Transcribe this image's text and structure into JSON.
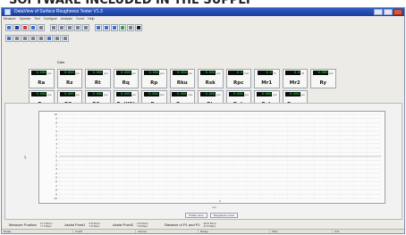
{
  "heading": "SOFTWARE INCLUDED IN THE SUPPLY",
  "window": {
    "title": "DataView of Surface Roughness Tester  V1.3",
    "menu": [
      "Measure",
      "Operate",
      "Tool",
      "Configure",
      "Analysis",
      "Curve",
      "Help"
    ]
  },
  "toolbar": {
    "row1": [
      "open-icon",
      "save-icon",
      "stop-icon",
      "chart-icon",
      "print-icon",
      "zoom-icon",
      "pen-icon",
      "level-icon",
      "scale-icon",
      "ruler-icon",
      "add-icon",
      "star-icon",
      "magnify-icon",
      "table-icon",
      "list-icon",
      "black-square-icon"
    ],
    "row2": [
      "home-icon",
      "play-icon",
      "grid-icon",
      "page-icon",
      "link-icon",
      "export-icon",
      "settings-icon",
      "undo-icon"
    ]
  },
  "params": {
    "date_label": "Date",
    "row1": [
      {
        "value": "0.000",
        "unit": "μm",
        "name": "Ra"
      },
      {
        "value": "0.000",
        "unit": "μm",
        "name": "Rz"
      },
      {
        "value": "0.000",
        "unit": "μm",
        "name": "Rt"
      },
      {
        "value": "0.000",
        "unit": "μm",
        "name": "Rq"
      },
      {
        "value": "0.000",
        "unit": "μm",
        "name": "Rp"
      },
      {
        "value": "0.000",
        "unit": "μm",
        "name": "Rku"
      },
      {
        "value": "0.000",
        "unit": "μm",
        "name": "Rsk"
      },
      {
        "value": "0.0",
        "unit": "mm",
        "name": "Rpc"
      },
      {
        "value": "0.0",
        "unit": "%",
        "name": "Mr1"
      },
      {
        "value": "0.0",
        "unit": "%",
        "name": "Mr2"
      },
      {
        "value": "0.000",
        "unit": "μm",
        "name": "Ry"
      }
    ],
    "row2": [
      {
        "value": "0.000",
        "unit": "μm",
        "name": "Rv"
      },
      {
        "value": "0.000",
        "unit": "μm",
        "name": "R3z"
      },
      {
        "value": "0.000",
        "unit": "μm",
        "name": "R3y"
      },
      {
        "value": "0.000",
        "unit": "μm",
        "name": "Rz(JIS)"
      },
      {
        "value": "0.000",
        "unit": "mm",
        "name": "Rs"
      },
      {
        "value": "0.000",
        "unit": "mm",
        "name": "Rsm"
      },
      {
        "value": "0.000",
        "unit": "μm",
        "name": "Rk"
      },
      {
        "value": "0.000",
        "unit": "μm",
        "name": "Rpk"
      },
      {
        "value": "0.000",
        "unit": "μm",
        "name": "Rvk"
      },
      {
        "value": "0.000",
        "unit": "μm",
        "name": "Rmax"
      }
    ]
  },
  "chart": {
    "y_label": "μm",
    "x_label": "mm",
    "buttons": [
      "Profile curve",
      "Roughness curve"
    ]
  },
  "chart_data": {
    "type": "line",
    "y_ticks": [
      "10",
      "9",
      "8",
      "7",
      "6",
      "5",
      "4",
      "3",
      "2",
      "1",
      "0",
      "-1",
      "-2",
      "-3",
      "-4",
      "-5",
      "-6",
      "-7",
      "-8",
      "-9",
      "-10"
    ],
    "x_ticks": [
      "0"
    ],
    "series": [],
    "grid": true
  },
  "bottom": {
    "measure_position_label": "Measure Position",
    "measure_position_values": [
      "X= 0.00mm",
      "Y= 0.00μm"
    ],
    "assist1_label": "Assist Point1",
    "assist1_values": [
      "X=0.00mm",
      "Y=0.00μm"
    ],
    "assist2_label": "Assist Point2",
    "assist2_values": [
      "X=0.00mm",
      "Y=0.00μm"
    ],
    "distance_label": "Distance of P1 and P2",
    "distance_values": [
      "ΔX=0.00mm",
      "ΔY=0.00μm"
    ]
  },
  "status": [
    "Ready",
    "Cutoff",
    "Acrusto",
    "Range",
    "Filter",
    "Unit"
  ],
  "colors": {
    "lcd_text": "#19e34a",
    "lcd_bg": "#0c0c0c",
    "titlebar": "#2f5cc7",
    "grid": "#c9ccd0"
  }
}
